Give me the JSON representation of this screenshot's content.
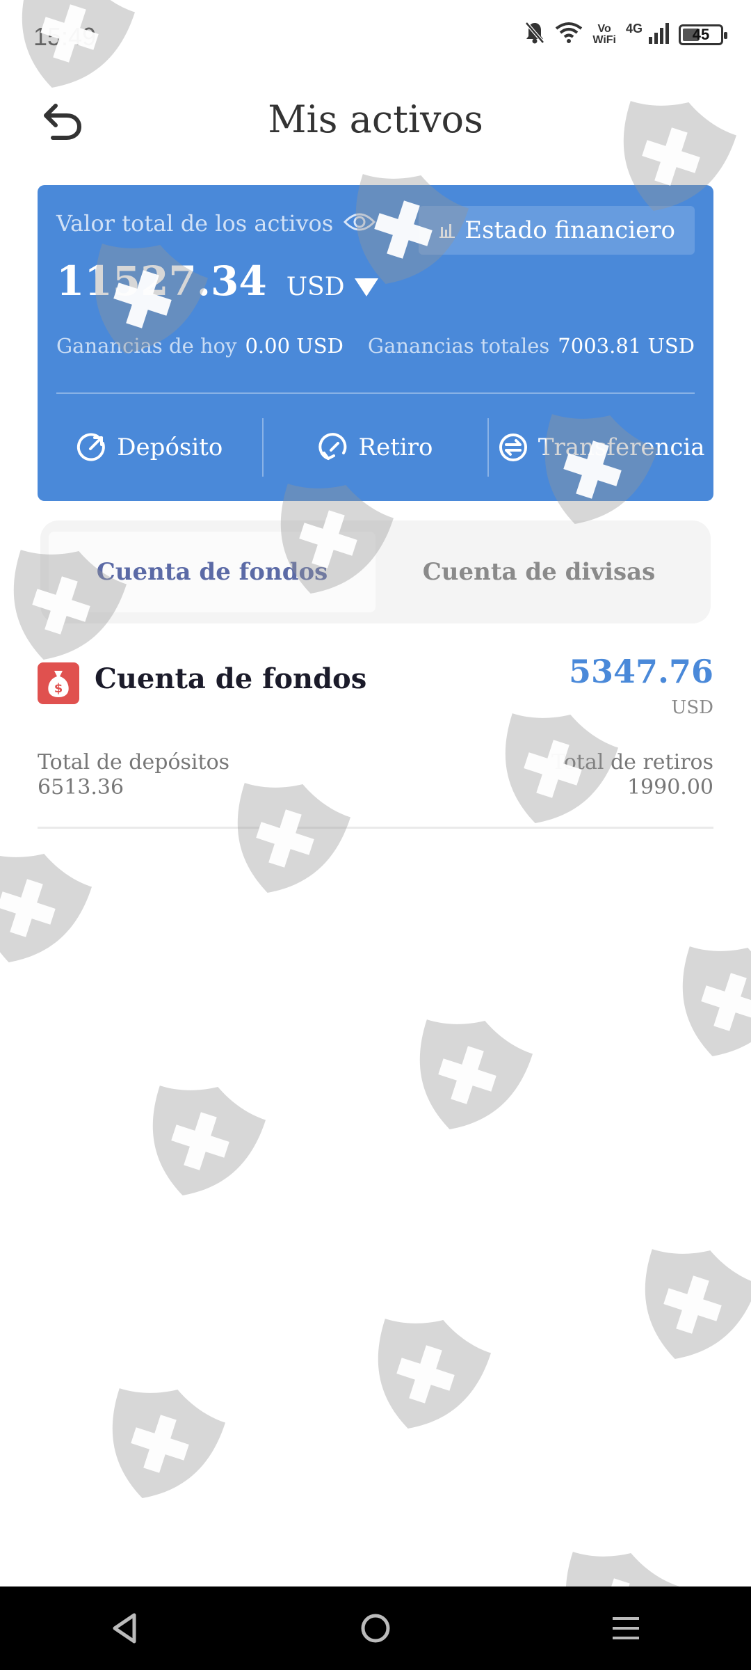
{
  "status_bar": {
    "time": "15:49",
    "network_type": "4G",
    "volte_line1": "Vo",
    "volte_line2": "WiFi",
    "battery_level": "45"
  },
  "header": {
    "title": "Mis activos"
  },
  "asset_card": {
    "total_label": "Valor total de los activos",
    "total_amount": "11527.34",
    "currency": "USD",
    "financial_statement_label": "Estado financiero",
    "today_earnings_label": "Ganancias de hoy",
    "today_earnings_value": "0.00 USD",
    "total_earnings_label": "Ganancias totales",
    "total_earnings_value": "7003.81 USD",
    "actions": [
      {
        "label": "Depósito",
        "icon": "deposit-icon"
      },
      {
        "label": "Retiro",
        "icon": "withdraw-icon"
      },
      {
        "label": "Transferencia",
        "icon": "transfer-icon"
      }
    ],
    "background_color": "#4a89d9"
  },
  "tabs": [
    {
      "label": "Cuenta de fondos",
      "active": true
    },
    {
      "label": "Cuenta de divisas",
      "active": false
    }
  ],
  "fund_account": {
    "title": "Cuenta de fondos",
    "balance": "5347.76",
    "currency": "USD",
    "deposits_label": "Total de depósitos",
    "deposits_value": "6513.36",
    "withdrawals_label": "Total de retiros",
    "withdrawals_value": "1990.00",
    "icon_color": "#e0514f"
  },
  "nav_bar": {
    "back_icon": "nav-back-icon",
    "home_icon": "nav-home-icon",
    "menu_icon": "nav-menu-icon"
  }
}
